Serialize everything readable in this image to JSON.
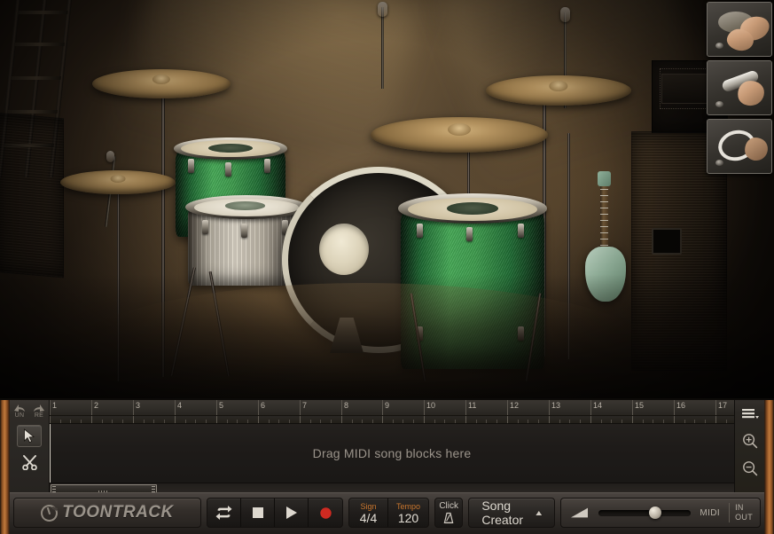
{
  "app": {
    "brand": "TOONTRACK"
  },
  "stage": {
    "name": "drum-kit-stage-view",
    "description": "Green sparkle drum kit on a lit stage"
  },
  "thumbnails": [
    {
      "name": "percussion-thumb-1",
      "icon": "hand-frame-drum-icon",
      "label": "Frame drum"
    },
    {
      "name": "percussion-thumb-2",
      "icon": "hand-shaker-icon",
      "label": "Shaker"
    },
    {
      "name": "percussion-thumb-3",
      "icon": "hand-tambourine-icon",
      "label": "Tambourine"
    }
  ],
  "editor": {
    "tools": {
      "undo_label": "UN",
      "redo_label": "RE",
      "pointer_icon": "pointer-arrow-icon",
      "scissors_icon": "scissors-icon"
    },
    "ruler": {
      "bars": [
        "1",
        "2",
        "3",
        "4",
        "5",
        "6",
        "7",
        "8",
        "9",
        "10",
        "11",
        "12",
        "13",
        "14",
        "15",
        "16",
        "17"
      ],
      "first_bar": 1,
      "last_bar": 17
    },
    "drop_hint": "Drag MIDI song blocks here",
    "playhead_bar": 1,
    "zoom": {
      "menu_icon": "hamburger-menu-icon",
      "zoom_in_icon": "zoom-in-icon",
      "zoom_out_icon": "zoom-out-icon"
    }
  },
  "transport": {
    "loop_label": "Loop",
    "stop_label": "Stop",
    "play_label": "Play",
    "record_label": "Record",
    "sign": {
      "key": "Sign",
      "value": "4/4"
    },
    "tempo": {
      "key": "Tempo",
      "value": "120"
    },
    "click": {
      "key": "Click",
      "icon": "metronome-icon"
    },
    "song_creator": {
      "label": "Song Creator",
      "caret": "▲"
    },
    "volume": {
      "icon": "volume-wedge-icon",
      "percent": 63
    },
    "midi": {
      "label": "MIDI",
      "in": "IN",
      "out": "OUT"
    }
  },
  "colors": {
    "accent_orange": "#c8762e",
    "frame_orange": "#c07a3c",
    "record_red": "#cf2a21",
    "text_light": "#ddd8cf",
    "panel_dark": "#201d1a"
  }
}
